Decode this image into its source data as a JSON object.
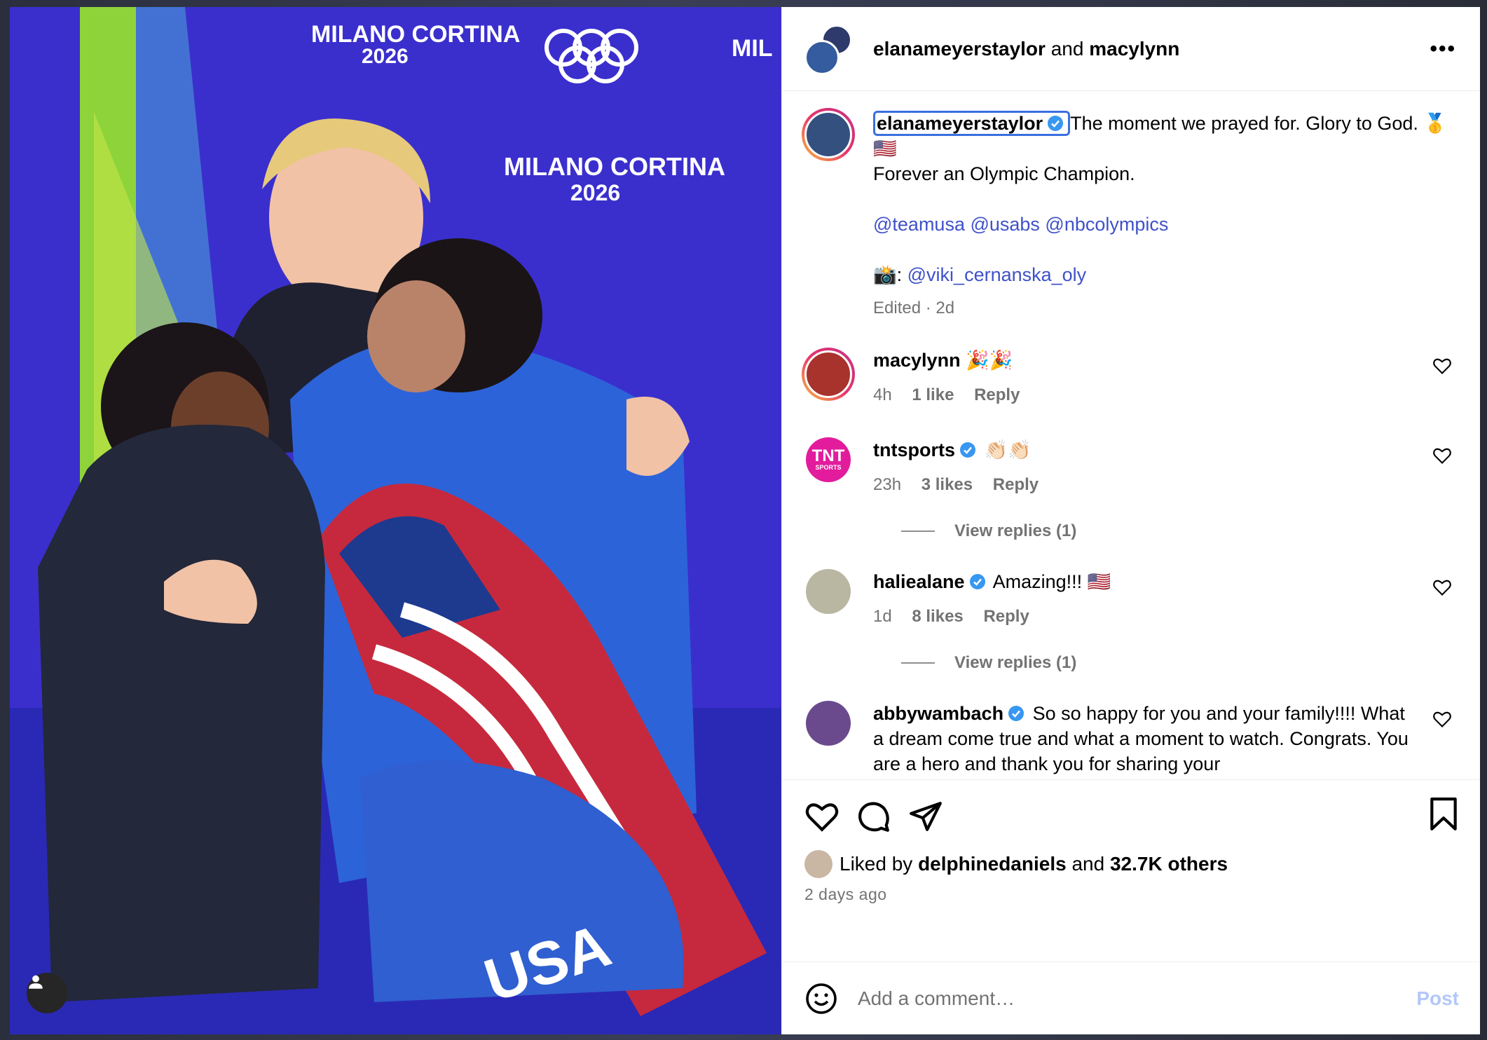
{
  "header": {
    "user1": "elanameyerstaylor",
    "and": "and",
    "user2": "macylynn"
  },
  "caption": {
    "username": "elanameyerstaylor",
    "line1": "The moment we prayed for. Glory to God. 🥇 🇺🇸",
    "line2": "Forever an Olympic Champion.",
    "mentions": "@teamusa @usabs @nbcolympics",
    "photo_prefix": "📸:",
    "photo_credit": "@viki_cernanska_oly",
    "edited": "Edited · 2d"
  },
  "comments": [
    {
      "username": "macylynn",
      "text": "🎉🎉",
      "time": "4h",
      "likes": "1 like",
      "reply": "Reply"
    },
    {
      "username": "tntsports",
      "text": "👏🏻👏🏻",
      "time": "23h",
      "likes": "3 likes",
      "reply": "Reply",
      "view_replies": "View replies (1)",
      "avatar_text": "TNT",
      "avatar_sub": "SPORTS"
    },
    {
      "username": "haliealane",
      "text": "Amazing!!! 🇺🇸",
      "time": "1d",
      "likes": "8 likes",
      "reply": "Reply",
      "view_replies": "View replies (1)"
    },
    {
      "username": "abbywambach",
      "text": "So so happy for you and your family!!!! What a dream come true and what a moment to watch. Congrats. You are a hero and thank you for sharing your"
    }
  ],
  "photo": {
    "sign_top": "MILANO CORTINA",
    "sign_year": "2026",
    "sign_partial": "MIL",
    "suit_text": "USA"
  },
  "likes": {
    "prefix": "Liked by",
    "user": "delphinedaniels",
    "and": "and",
    "count": "32.7K others"
  },
  "timestamp": "2 days ago",
  "composer": {
    "placeholder": "Add a comment…",
    "post": "Post"
  },
  "colors": {
    "backdrop_purple": "#3b2fc9",
    "mention_blue": "#3f51c9",
    "verified_blue": "#3897f0",
    "post_disabled": "#b3c7f9"
  }
}
